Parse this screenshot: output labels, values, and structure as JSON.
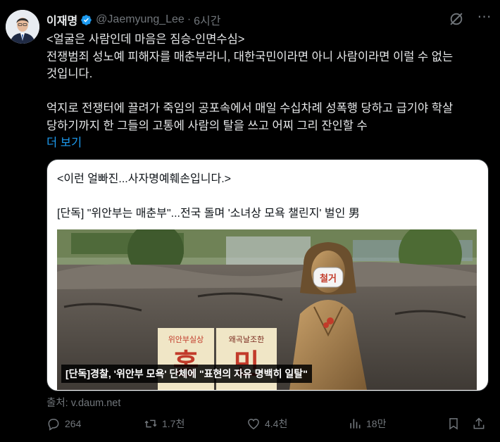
{
  "author": {
    "name": "이재명",
    "handle": "@Jaemyung_Lee",
    "time": "6시간"
  },
  "tweet": {
    "line1": "<얼굴은 사람인데 마음은 짐승-인면수심>",
    "line2": "전쟁범죄 성노예 피해자를 매춘부라니, 대한국민이라면 아니 사람이라면 이럴 수 없는",
    "line3": "것입니다.",
    "line4": "억지로 전쟁터에 끌려가 죽임의 공포속에서 매일 수십차례 성폭행 당하고 급기야 학살",
    "line5": "당하기까지 한 그들의 고통에 사람의 탈을 쓰고 어찌 그리 잔인할 수",
    "show_more": "더 보기"
  },
  "card": {
    "title": "<이런 얼빠진...사자명예훼손입니다.>",
    "headline": "[단독] \"위안부는 매춘부\"...전국 돌며 '소녀상 모욕 챌린지' 벌인 男",
    "image_caption": "[단독]경찰, '위안부 모욕' 단체에 \"표현의 자유 명백히 일탈\"",
    "mask_text": "철거",
    "sign_left_top": "위안부실상",
    "sign_left_big": "홍",
    "sign_right_top": "왜곡날조한",
    "sign_right_big": "민"
  },
  "source": "출처: v.daum.net",
  "actions": {
    "replies": "264",
    "retweets": "1.7천",
    "likes": "4.4천",
    "views": "18만"
  },
  "colors": {
    "background": "#000000",
    "text": "#e7e9ea",
    "muted": "#71767b",
    "link": "#1d9bf0",
    "verified": "#1d9bf0"
  }
}
